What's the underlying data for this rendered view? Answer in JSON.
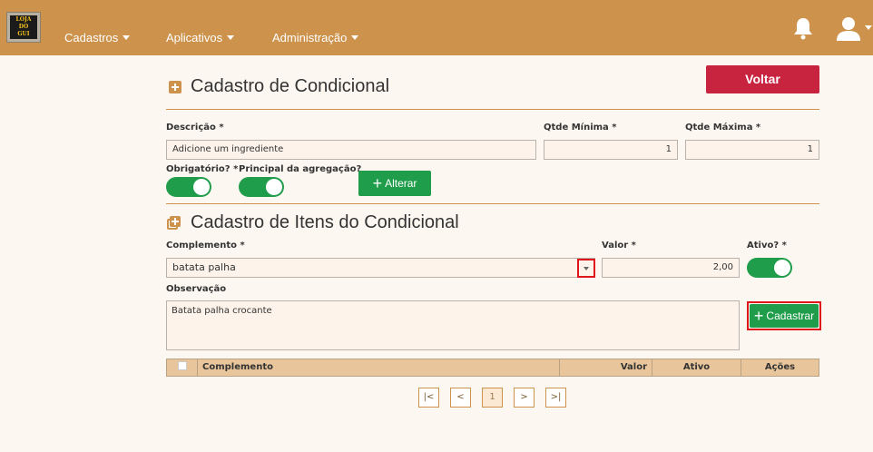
{
  "nav": {
    "logo_lines": [
      "LOJA",
      "DO",
      "GUI"
    ],
    "items": [
      "Cadastros",
      "Aplicativos",
      "Administração"
    ]
  },
  "header": {
    "title": "Cadastro de Condicional",
    "back_label": "Voltar"
  },
  "condicional": {
    "descricao_label": "Descrição *",
    "descricao_value": "Adicione um ingrediente",
    "qtde_min_label": "Qtde Mínima *",
    "qtde_min_value": "1",
    "qtde_max_label": "Qtde Máxima *",
    "qtde_max_value": "1",
    "obrigatorio_label": "Obrigatório? *",
    "principal_label": "Principal da agregação?",
    "alterar_label": "Alterar"
  },
  "itens": {
    "title": "Cadastro de Itens do Condicional",
    "complemento_label": "Complemento *",
    "complemento_value": "batata palha",
    "valor_label": "Valor *",
    "valor_value": "2,00",
    "ativo_label": "Ativo? *",
    "observacao_label": "Observação",
    "observacao_value": "Batata palha crocante",
    "cadastrar_label": "Cadastrar"
  },
  "table": {
    "columns": [
      "Complemento",
      "Valor",
      "Ativo",
      "Ações"
    ]
  },
  "pagination": {
    "first": "|<",
    "prev": "<",
    "current": "1",
    "next": ">",
    "last": ">|"
  },
  "colors": {
    "brand": "#cd924b",
    "danger": "#c8233f",
    "success": "#1f9d4b"
  }
}
